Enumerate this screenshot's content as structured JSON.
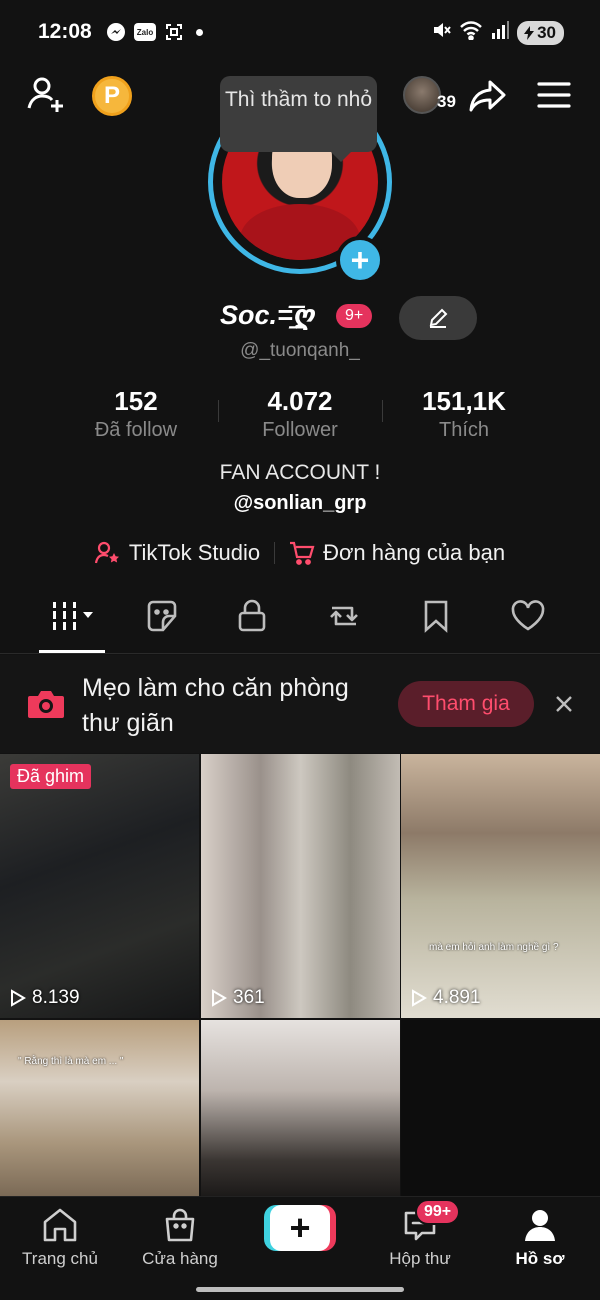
{
  "status_bar": {
    "time": "12:08",
    "zalo_label": "Zalo",
    "battery": "30"
  },
  "top_bar": {
    "visitor_count": "39"
  },
  "tooltip": {
    "text": "Thì thầm to nhỏ"
  },
  "profile": {
    "display_name": "Soc.=͟͟͞͞ღ",
    "notif_badge": "9+",
    "handle": "@_tuonqanh_",
    "bio_line1": "FAN ACCOUNT !",
    "bio_line2": "@sonlian_grp"
  },
  "stats": [
    {
      "value": "152",
      "label": "Đã follow"
    },
    {
      "value": "4.072",
      "label": "Follower"
    },
    {
      "value": "151,1K",
      "label": "Thích"
    }
  ],
  "links": {
    "studio": "TikTok Studio",
    "orders": "Đơn hàng của bạn"
  },
  "banner": {
    "text": "Mẹo làm cho căn phòng thư giãn",
    "join_label": "Tham gia"
  },
  "videos": [
    {
      "views": "8.139",
      "pinned_label": "Đã ghim"
    },
    {
      "views": "361"
    },
    {
      "views": "4.891",
      "caption": "mà em hỏi anh làm nghề gì ?"
    },
    {
      "caption": "\" Rằng thì là mà em ... \""
    },
    {}
  ],
  "bottom_nav": [
    {
      "label": "Trang chủ"
    },
    {
      "label": "Cửa hàng"
    },
    {
      "label": "Hộp thư",
      "badge": "99+"
    },
    {
      "label": "Hồ sơ"
    }
  ]
}
